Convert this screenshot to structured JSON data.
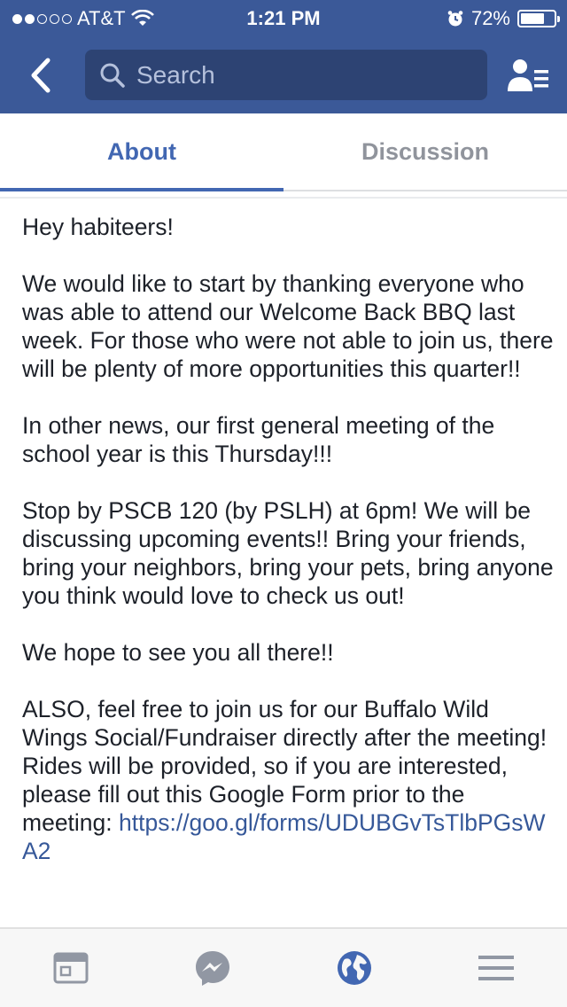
{
  "status_bar": {
    "carrier": "AT&T",
    "time": "1:21 PM",
    "battery_percent": "72%",
    "battery_level": 0.72,
    "signal_bars_filled": 2,
    "signal_bars_total": 5
  },
  "nav": {
    "search_placeholder": "Search"
  },
  "tabs": [
    {
      "label": "About",
      "active": true
    },
    {
      "label": "Discussion",
      "active": false
    }
  ],
  "content": {
    "paragraphs": [
      "Hey habiteers!",
      "We would like to start by thanking everyone who was able to attend our Welcome Back BBQ last week. For those who were not able to join us, there will be plenty of more opportunities this quarter!!",
      "In other news, our first general meeting of the school year is this Thursday!!!",
      "Stop by PSCB 120 (by PSLH) at 6pm! We will be discussing upcoming events!! Bring your friends, bring your neighbors, bring your pets, bring anyone you think would love to check us out!",
      "We hope to see you all there!!"
    ],
    "final_paragraph_text": "ALSO, feel free to join us for our Buffalo Wild Wings Social/Fundraiser directly after the meeting! Rides will be provided, so if you are interested, please fill out this Google Form prior to the meeting: ",
    "form_link": "https://goo.gl/forms/UDUBGvTsTlbPGsWA2"
  },
  "bottom_bar": {
    "items": [
      {
        "icon": "news-feed-icon",
        "active": false
      },
      {
        "icon": "messenger-icon",
        "active": false
      },
      {
        "icon": "globe-icon",
        "active": true
      },
      {
        "icon": "menu-icon",
        "active": false
      }
    ]
  },
  "colors": {
    "header_blue": "#3b5998",
    "accent_blue": "#4267b2",
    "link_blue": "#365899",
    "inactive_gray": "#90949c"
  }
}
